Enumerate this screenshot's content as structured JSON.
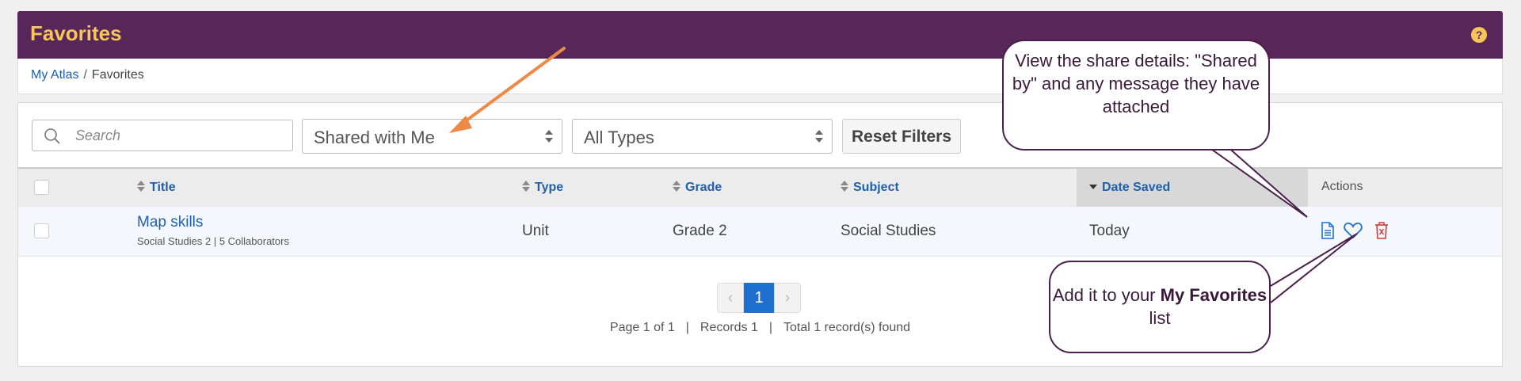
{
  "header": {
    "title": "Favorites",
    "help_icon": "question-icon"
  },
  "breadcrumb": {
    "items": [
      "My Atlas",
      "Favorites"
    ],
    "separator": "/"
  },
  "filters": {
    "search_placeholder": "Search",
    "shared_select": "Shared with Me",
    "type_select": "All Types",
    "reset_label": "Reset Filters"
  },
  "table": {
    "columns": [
      "Title",
      "Type",
      "Grade",
      "Subject",
      "Date Saved",
      "Actions"
    ],
    "rows": [
      {
        "title": "Map skills",
        "meta": "Social Studies 2 | 5 Collaborators",
        "type": "Unit",
        "grade": "Grade 2",
        "subject": "Social Studies",
        "date_saved": "Today",
        "actions": [
          "document-icon",
          "heart-icon",
          "trash-icon"
        ]
      }
    ]
  },
  "pagination": {
    "current_page": "1",
    "page_info": "Page 1 of 1",
    "records": "Records 1",
    "total": "Total 1 record(s) found",
    "divider": "|"
  },
  "callouts": {
    "share_details": "View the share details: \"Shared by\" and any message they have attached",
    "favorites_prefix": "Add it to your ",
    "favorites_bold": "My Favorites",
    "favorites_suffix": " list"
  },
  "colors": {
    "header_bg": "#582759",
    "header_title": "#f6c65b",
    "link": "#1f5fb0",
    "arrow": "#ef8a46"
  }
}
